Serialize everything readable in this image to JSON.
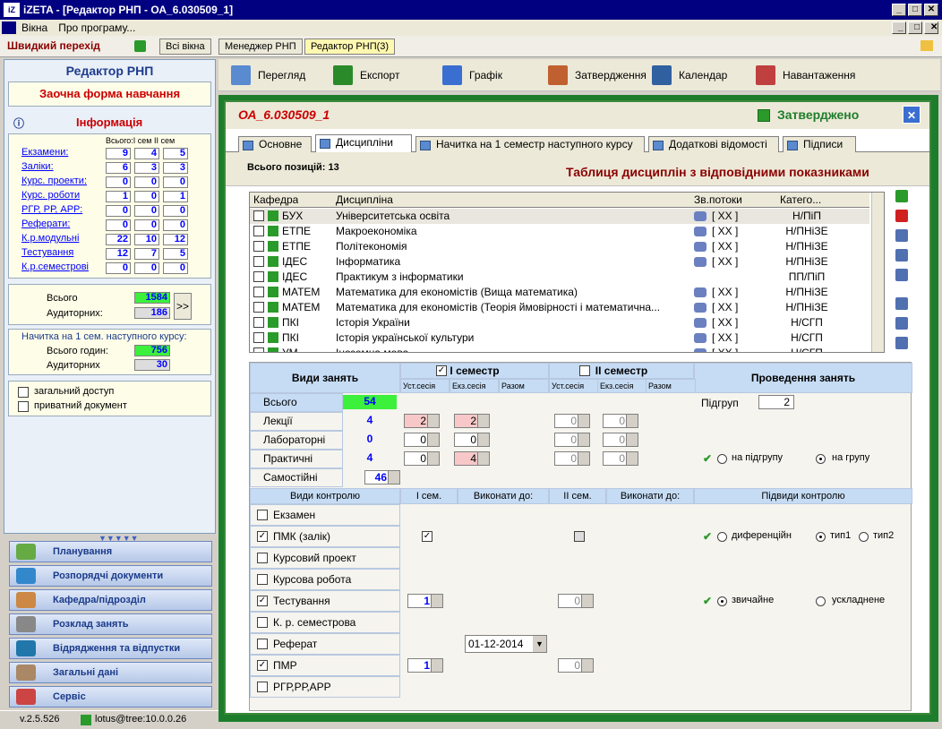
{
  "window": {
    "title": "iZETA - [Редактор РНП - ОА_6.030509_1]",
    "logo": "iZ"
  },
  "menu": [
    "Вікна",
    "Про програму..."
  ],
  "quickbar": {
    "label": "Швидкий перехід",
    "tabs": [
      "Всі вікна",
      "Менеджер РНП",
      "Редактор РНП(3)"
    ]
  },
  "left": {
    "title": "Редактор РНП",
    "form": "Заочна форма навчання",
    "info_title": "Інформація",
    "col_headers": "Всього:І сем ІІ сем",
    "rows": [
      {
        "label": "Екзамени:",
        "v": [
          "9",
          "4",
          "5"
        ]
      },
      {
        "label": "Заліки:",
        "v": [
          "6",
          "3",
          "3"
        ]
      },
      {
        "label": "Курс. проекти:",
        "v": [
          "0",
          "0",
          "0"
        ]
      },
      {
        "label": "Курс. роботи",
        "v": [
          "1",
          "0",
          "1"
        ]
      },
      {
        "label": "РГР, РР, АРР:",
        "v": [
          "0",
          "0",
          "0"
        ]
      },
      {
        "label": "Реферати:",
        "v": [
          "0",
          "0",
          "0"
        ]
      },
      {
        "label": "К.р.модульні",
        "v": [
          "22",
          "10",
          "12"
        ]
      },
      {
        "label": "Тестування",
        "v": [
          "12",
          "7",
          "5"
        ]
      },
      {
        "label": "К.р.семестрові",
        "v": [
          "0",
          "0",
          "0"
        ]
      }
    ],
    "total_label": "Всього",
    "total": "1584",
    "aud_label": "Аудиторних:",
    "aud": "186",
    "arrow": ">>",
    "next_title": "Начитка на 1 сем. наступного курсу:",
    "next_total_label": "Всього годин:",
    "next_total": "756",
    "next_aud_label": "Аудиторних",
    "next_aud": "30",
    "cb1": "загальний доступ",
    "cb2": "приватний документ"
  },
  "nav": [
    "Планування",
    "Розпорядчі документи",
    "Кафедра/підрозділ",
    "Розклад занять",
    "Відрядження та відпустки",
    "Загальні дані",
    "Сервіс"
  ],
  "status": {
    "version": "v.2.5.526",
    "user": "lotus@tree:10.0.0.26"
  },
  "toolbar": [
    "Перегляд",
    "Експорт",
    "Графік",
    "Затвердження",
    "Календар",
    "Навантаження"
  ],
  "doc": {
    "title": "ОА_6.030509_1",
    "state": "Затверджено",
    "close": "✕"
  },
  "tabs": [
    "Основне",
    "Дисципліни",
    "Начитка на 1 семестр наступного курсу",
    "Додаткові відомості",
    "Підписи"
  ],
  "positions": "Всього позицій: 13",
  "table_title": "Таблиця дисциплін з відповідними показниками",
  "grid": {
    "headers": [
      "Кафедра",
      "Дисципліна",
      "Зв.потоки",
      "Катего..."
    ],
    "rows": [
      {
        "k": "БУХ",
        "d": "Університетська освіта",
        "p": "[ XX ]",
        "c": "Н/ПіП",
        "sel": true
      },
      {
        "k": "ЕТПЕ",
        "d": "Макроекономіка",
        "p": "[ XX ]",
        "c": "Н/ПНіЗЕ"
      },
      {
        "k": "ЕТПЕ",
        "d": "Політекономія",
        "p": "[ XX ]",
        "c": "Н/ПНіЗЕ"
      },
      {
        "k": "ІДЕС",
        "d": "Інформатика",
        "p": "[ XX ]",
        "c": "Н/ПНіЗЕ"
      },
      {
        "k": "ІДЕС",
        "d": "Практикум з інформатики",
        "p": "",
        "c": "ПП/ПіП"
      },
      {
        "k": "МАТЕМ",
        "d": "Математика для економістів (Вища математика)",
        "p": "[ XX ]",
        "c": "Н/ПНіЗЕ"
      },
      {
        "k": "МАТЕМ",
        "d": "Математика для економістів (Теорія ймовірності і математична...",
        "p": "[ XX ]",
        "c": "Н/ПНіЗЕ"
      },
      {
        "k": "ПКІ",
        "d": "Історія України",
        "p": "[ XX ]",
        "c": "Н/СГП"
      },
      {
        "k": "ПКІ",
        "d": "Історія української культури",
        "p": "[ XX ]",
        "c": "Н/СГП"
      },
      {
        "k": "УМ",
        "d": "Іноземна мова",
        "p": "[ XX ]",
        "c": "Н/СГП"
      }
    ]
  },
  "lower": {
    "vid": "Види занять",
    "sem1": "І семестр",
    "sem2": "ІІ семестр",
    "prov": "Проведення занять",
    "sub": [
      "Уст.сесія",
      "Екз.сесія",
      "Разом",
      "Уст.сесія",
      "Екз.сесія",
      "Разом"
    ],
    "vsogo": "Всього",
    "vsogo_val": "54",
    "pidgrup": "Підгруп",
    "pidgrup_val": "2",
    "lek": "Лекції",
    "lek_val": "4",
    "lek_a": "2",
    "lek_b": "2",
    "lek_c": "0",
    "lek_d": "0",
    "lab": "Лабораторні",
    "lab_val": "0",
    "lab_a": "0",
    "lab_b": "0",
    "lab_c": "0",
    "lab_d": "0",
    "pr": "Практичні",
    "pr_val": "4",
    "pr_a": "0",
    "pr_b": "4",
    "pr_c": "0",
    "pr_d": "0",
    "na_pidgrupu": "на підгрупу",
    "na_grupu": "на групу",
    "sam": "Самостійні",
    "sam_val": "46",
    "kh": [
      "Види контролю",
      "І сем.",
      "Виконати до:",
      "ІІ сем.",
      "Виконати до:",
      "Підвиди контролю"
    ],
    "controls": [
      {
        "l": "Екзамен",
        "on": false
      },
      {
        "l": "ПМК (залік)",
        "on": true
      },
      {
        "l": "Курсовий проект",
        "on": false
      },
      {
        "l": "Курсова робота",
        "on": false
      },
      {
        "l": "Тестування",
        "on": true
      },
      {
        "l": "К. р. семестрова",
        "on": false
      },
      {
        "l": "Реферат",
        "on": false
      },
      {
        "l": "ПМР",
        "on": true
      },
      {
        "l": "РГР,РР,АРР",
        "on": false
      }
    ],
    "dif": "диференційн",
    "tip1": "тип1",
    "tip2": "тип2",
    "zv": "звичайне",
    "usk": "ускладнене",
    "test1": "1",
    "test2": "0",
    "pmr1": "1",
    "pmr2": "0",
    "date": "01-12-2014"
  }
}
